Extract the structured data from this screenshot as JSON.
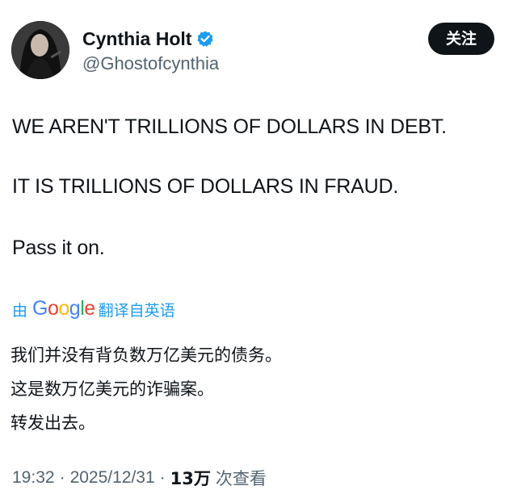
{
  "author": {
    "display_name": "Cynthia Holt",
    "handle": "@Ghostofcynthia",
    "verified": true
  },
  "actions": {
    "follow_label": "关注"
  },
  "post": {
    "lines": [
      "WE AREN'T TRILLIONS OF DOLLARS IN DEBT.",
      "IT IS TRILLIONS OF DOLLARS IN FRAUD.",
      "Pass it on."
    ]
  },
  "translation": {
    "prefix": "由",
    "provider": [
      "G",
      "o",
      "o",
      "g",
      "l",
      "e"
    ],
    "suffix": "翻译自英语",
    "lines": [
      "我们并没有背负数万亿美元的债务。",
      "这是数万亿美元的诈骗案。",
      "转发出去。"
    ]
  },
  "meta": {
    "time": "19:32",
    "separator": "·",
    "date": "2025/12/31",
    "views_count": "13万",
    "views_label": "次查看"
  },
  "colors": {
    "accent": "#1d9bf0",
    "follow_button_bg": "#0f1419",
    "text_primary": "#0f1419",
    "text_secondary": "#536471",
    "google_blue": "#4285f4",
    "google_red": "#ea4335",
    "google_yellow": "#fbbc05",
    "google_green": "#34a853"
  },
  "icons": {
    "verified": "verified-badge-icon",
    "avatar": "profile-photo"
  }
}
